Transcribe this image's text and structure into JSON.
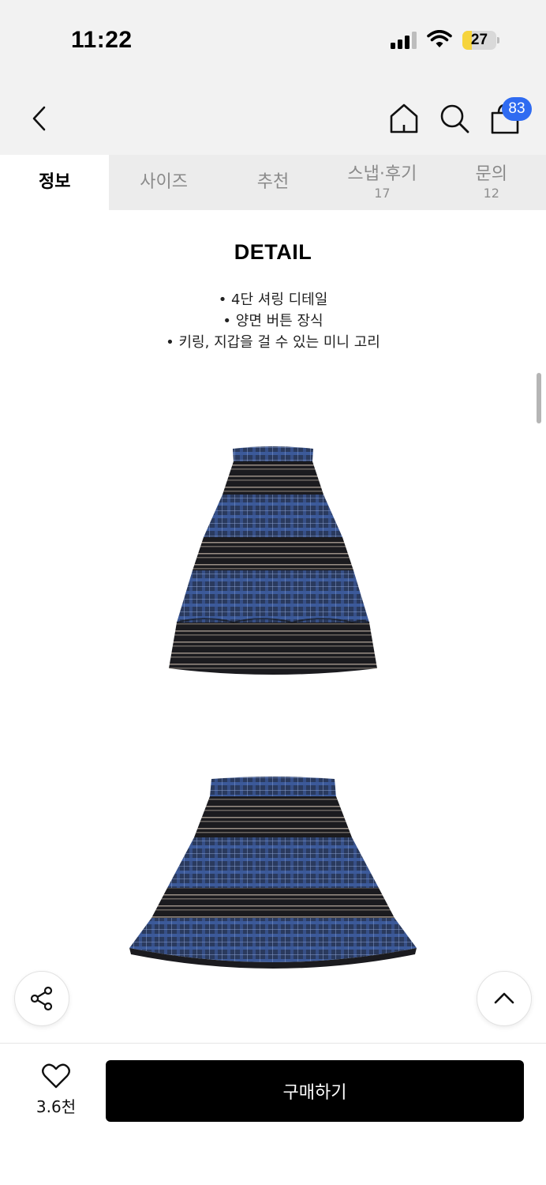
{
  "status_bar": {
    "time": "11:22",
    "battery": "27",
    "battery_level": 0.27,
    "icons": [
      "cellular-signal-icon",
      "wifi-icon",
      "battery-icon"
    ]
  },
  "nav": {
    "back_icon": "chevron-left-icon",
    "home_icon": "home-icon",
    "search_icon": "search-icon",
    "cart_icon": "shopping-bag-icon",
    "cart_badge": "83",
    "badge_color": "#2f6bf1"
  },
  "tabs": [
    {
      "label": "정보",
      "count": "",
      "active": true
    },
    {
      "label": "사이즈",
      "count": "",
      "active": false
    },
    {
      "label": "추천",
      "count": "",
      "active": false
    },
    {
      "label": "스냅·후기",
      "count": "17",
      "active": false
    },
    {
      "label": "문의",
      "count": "12",
      "active": false
    }
  ],
  "detail": {
    "title": "DETAIL",
    "bullets": [
      "4단 셔링 디테일",
      "양면 버튼 장식",
      "키링, 지갑을 걸 수 있는 미니 고리"
    ]
  },
  "images": [
    {
      "name": "long-tiered-plaid-skirt-photo"
    },
    {
      "name": "short-tiered-plaid-skirt-photo"
    }
  ],
  "floating": {
    "share_icon": "share-icon",
    "top_icon": "chevron-up-icon"
  },
  "bottom": {
    "like_icon": "heart-icon",
    "like_count": "3.6천",
    "buy_label": "구매하기",
    "buy_color": "#000000"
  }
}
